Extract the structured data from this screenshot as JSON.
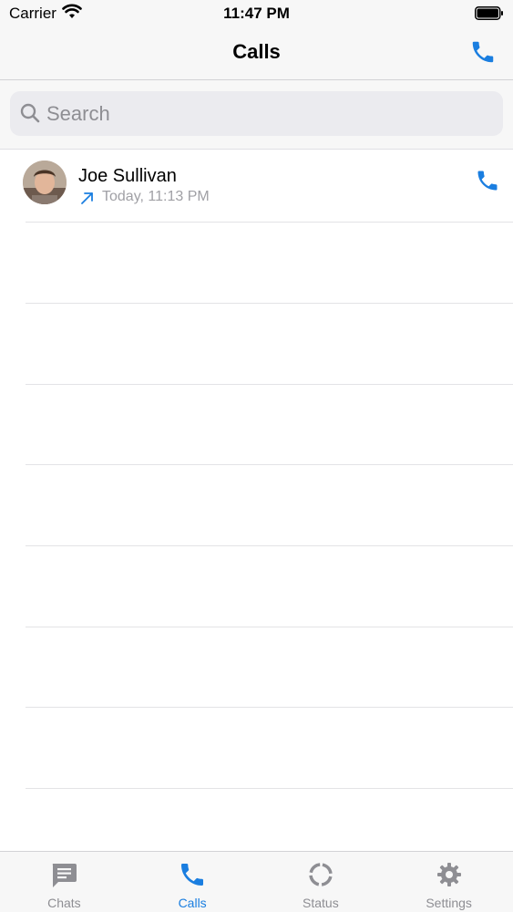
{
  "status_bar": {
    "carrier": "Carrier",
    "time": "11:47 PM"
  },
  "nav": {
    "title": "Calls"
  },
  "search": {
    "placeholder": "Search"
  },
  "calls": [
    {
      "name": "Joe Sullivan",
      "time": "Today, 11:13 PM",
      "direction": "outgoing"
    }
  ],
  "tabs": [
    {
      "label": "Chats",
      "icon": "chat-bubble-icon",
      "active": false
    },
    {
      "label": "Calls",
      "icon": "phone-icon",
      "active": true
    },
    {
      "label": "Status",
      "icon": "status-ring-icon",
      "active": false
    },
    {
      "label": "Settings",
      "icon": "gear-icon",
      "active": false
    }
  ],
  "colors": {
    "accent": "#1a7ee0",
    "inactive": "#8e8e93",
    "bar_bg": "#f7f7f7"
  }
}
